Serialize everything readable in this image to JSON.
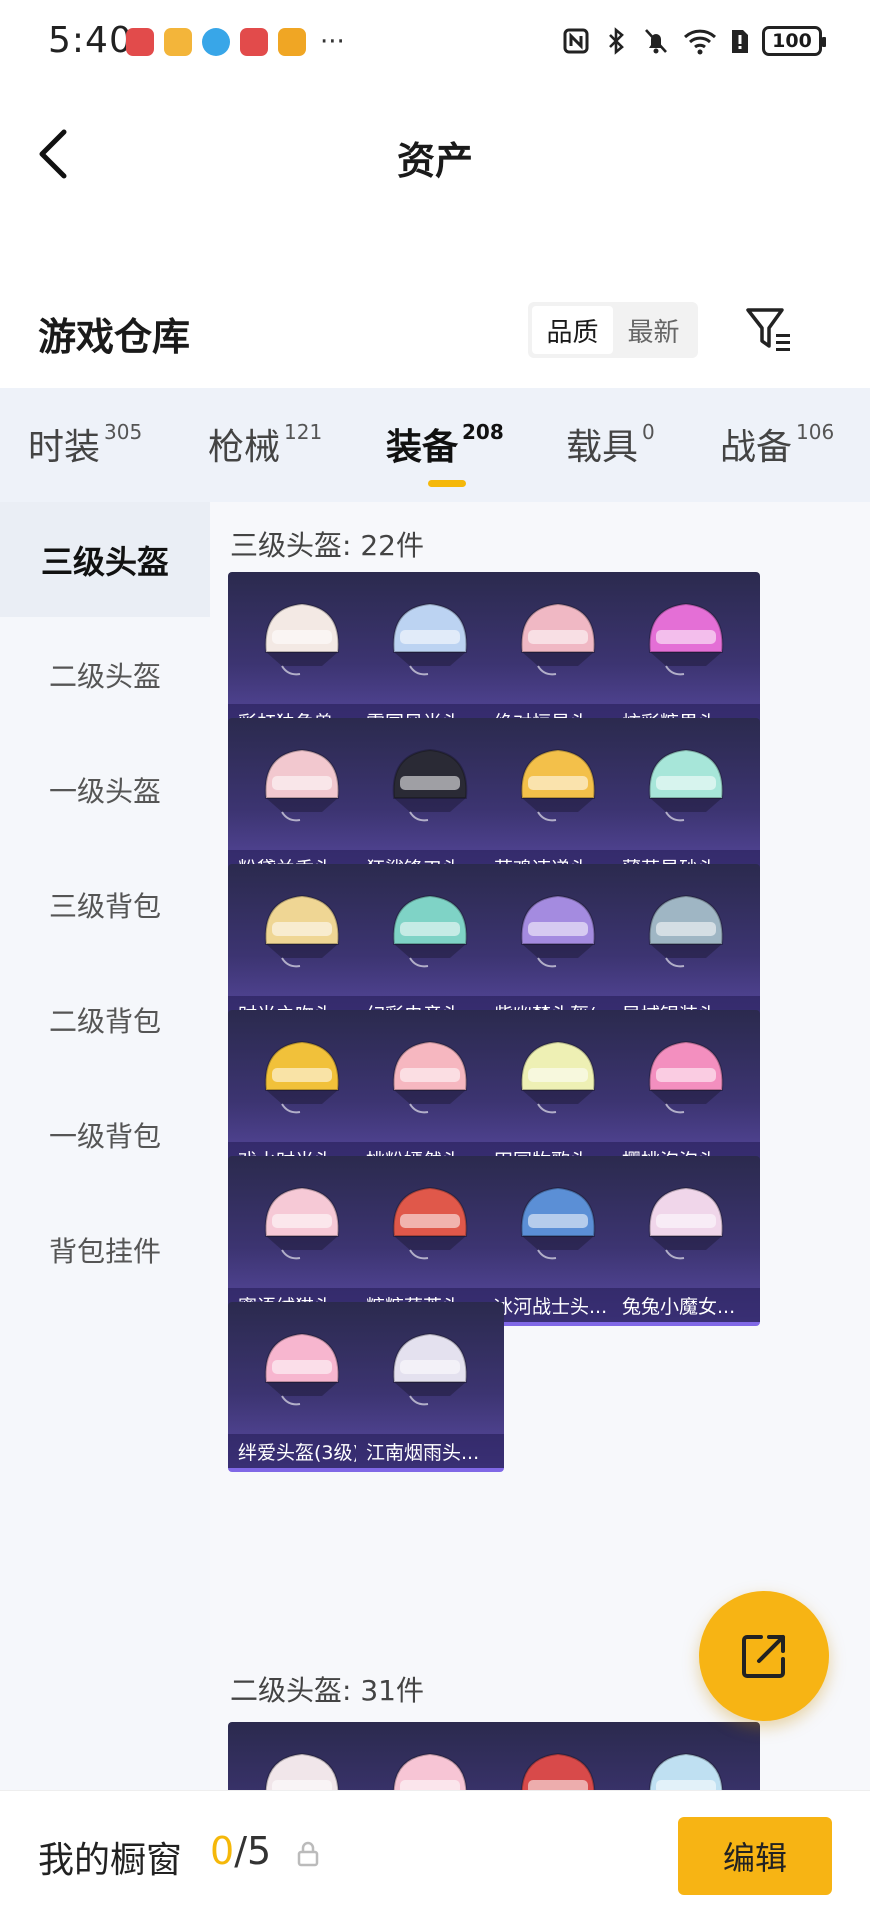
{
  "status_bar": {
    "time": "5:40",
    "battery": "100",
    "app_icon_colors": [
      "#e24b4b",
      "#f3b53a",
      "#38a6e8",
      "#e24b4b",
      "#f0a624"
    ]
  },
  "header": {
    "title": "资产",
    "back_icon": "chevron-left-icon"
  },
  "warehouse": {
    "title": "游戏仓库",
    "sort_options": [
      "品质",
      "最新"
    ],
    "active_sort": "品质",
    "filter_icon": "filter-icon"
  },
  "tabs": [
    {
      "label": "时装",
      "count": "305"
    },
    {
      "label": "枪械",
      "count": "121"
    },
    {
      "label": "装备",
      "count": "208"
    },
    {
      "label": "载具",
      "count": "0"
    },
    {
      "label": "战备",
      "count": "106"
    }
  ],
  "active_tab": "装备",
  "sidebar": {
    "items": [
      "三级头盔",
      "二级头盔",
      "一级头盔",
      "三级背包",
      "二级背包",
      "一级背包",
      "背包挂件"
    ],
    "active": "三级头盔"
  },
  "sections": [
    {
      "title": "三级头盔: 22件",
      "items": [
        "彩虹独角兽...",
        "雪国风尚头...",
        "绝对恒星头...",
        "炫彩糖果头...",
        "粉黛兰香头...",
        "狂鲨锋刃头...",
        "萌鸡速递头...",
        "薄荷星砂头...",
        "时光之吻头...",
        "幻彩电音头...",
        "紫幽梦头盔(...",
        "异域银装头...",
        "戏水时光头...",
        "桃粉嫣然头...",
        "田园牧歌头...",
        "樱桃泡泡头...",
        "蜜语绒猫头...",
        "糖糖葫芦头...",
        "冰河战士头...",
        "兔兔小魔女...",
        "绊爱头盔(3级)",
        "江南烟雨头..."
      ],
      "item_colors": [
        "#f3e9e4",
        "#bcd3f2",
        "#f0b8c4",
        "#e46fd6",
        "#f2c8cf",
        "#2a2a35",
        "#f3c04a",
        "#a7e6d9",
        "#efd694",
        "#7fd3c6",
        "#a48be0",
        "#9fb6c4",
        "#f1c13a",
        "#f6b7c0",
        "#eef0b4",
        "#f38fbf",
        "#f6c9d6",
        "#e0584a",
        "#5b8fd6",
        "#f0d6ea",
        "#f7b6cf",
        "#e4e1ef"
      ]
    },
    {
      "title": "二级头盔: 31件",
      "item_colors": [
        "#f1e6ea",
        "#f7c5d5",
        "#d84a4a",
        "#bfe0f2"
      ]
    }
  ],
  "share_button": {
    "icon": "share-icon"
  },
  "bottom_bar": {
    "label": "我的橱窗",
    "count_current": "0",
    "count_total": "/5",
    "lock_icon": "lock-icon",
    "edit_label": "编辑"
  },
  "colors": {
    "accent": "#f7b414",
    "card_top": "#2b2a4e",
    "card_bottom": "#5a4ba3"
  }
}
